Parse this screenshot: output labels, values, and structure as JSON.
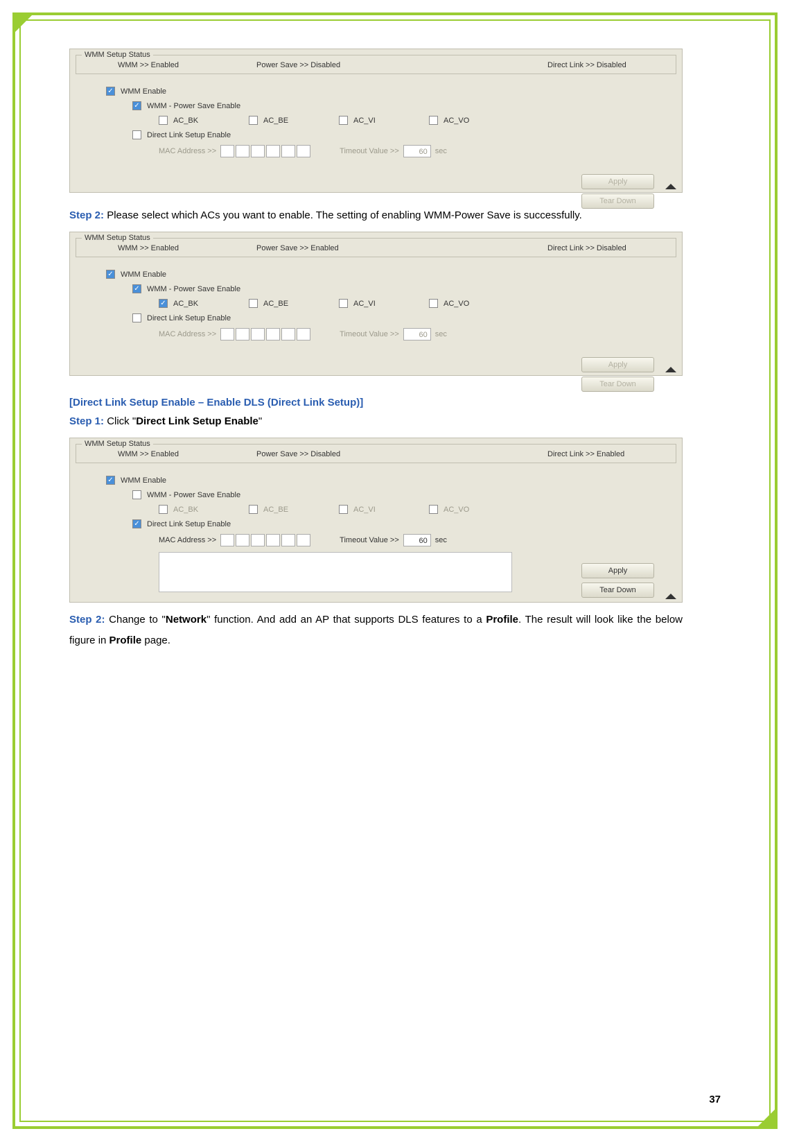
{
  "pageNumber": "37",
  "common": {
    "fieldsetLabel": "WMM Setup Status",
    "wmmEnable": "WMM Enable",
    "powerSaveEnable": "WMM - Power Save Enable",
    "ac_bk": "AC_BK",
    "ac_be": "AC_BE",
    "ac_vi": "AC_VI",
    "ac_vo": "AC_VO",
    "directLinkSetupEnable": "Direct Link Setup Enable",
    "macAddressLabel": "MAC Address >>",
    "timeoutLabel": "Timeout Value >>",
    "timeoutValue": "60",
    "secLabel": "sec",
    "applyBtn": "Apply",
    "tearDownBtn": "Tear Down"
  },
  "panel1": {
    "wmmStatus": "WMM >> Enabled",
    "powerSaveStatus": "Power Save >> Disabled",
    "directLinkStatus": "Direct Link >> Disabled"
  },
  "step2a": {
    "label": "Step 2: ",
    "text": "Please select which ACs you want to enable. The setting of enabling WMM-Power Save is successfully."
  },
  "panel2": {
    "wmmStatus": "WMM >> Enabled",
    "powerSaveStatus": "Power Save >> Enabled",
    "directLinkStatus": "Direct Link >> Disabled"
  },
  "sectionDLS": "[Direct Link Setup Enable – Enable DLS (Direct Link Setup)]",
  "step1b": {
    "label": "Step 1: ",
    "textPre": "Click \"",
    "textBold": "Direct Link Setup Enable",
    "textPost": "\""
  },
  "panel3": {
    "wmmStatus": "WMM >> Enabled",
    "powerSaveStatus": "Power Save >> Disabled",
    "directLinkStatus": "Direct Link >> Enabled"
  },
  "step2b": {
    "label": "Step 2: ",
    "textPre": "Change to \"",
    "textBold1": "Network",
    "textMid1": "\" function. And add an AP that supports DLS features to a ",
    "textBold2": "Profile",
    "textMid2": ". The result will look like the below figure in ",
    "textBold3": "Profile",
    "textPost": " page."
  }
}
